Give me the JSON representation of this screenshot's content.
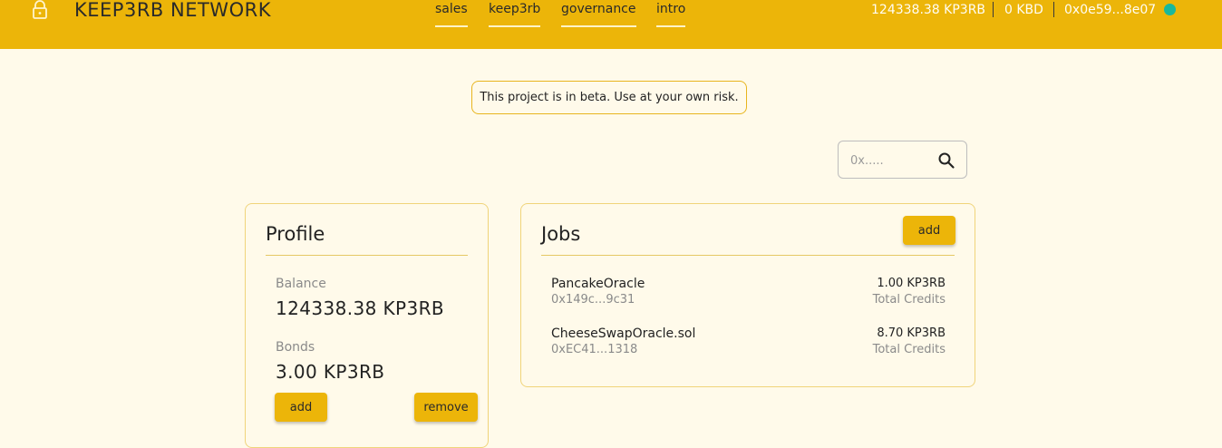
{
  "header": {
    "brand": "KEEP3RB NETWORK",
    "nav": [
      "sales",
      "keep3rb",
      "governance",
      "intro"
    ],
    "balance": "124338.38 KP3RB",
    "kbd": "0 KBD",
    "address": "0x0e59...8e07",
    "status_color": "#1ab89c",
    "accent_color": "#ecb509"
  },
  "notice": "This project is in beta. Use at your own risk.",
  "search": {
    "placeholder": "0x.....",
    "value": ""
  },
  "profile": {
    "title": "Profile",
    "balance_label": "Balance",
    "balance_value": "124338.38 KP3RB",
    "bonds_label": "Bonds",
    "bonds_value": "3.00 KP3RB",
    "add_label": "add",
    "remove_label": "remove"
  },
  "jobs": {
    "title": "Jobs",
    "add_label": "add",
    "items": [
      {
        "name": "PancakeOracle",
        "address": "0x149c...9c31",
        "credits": "1.00 KP3RB",
        "credits_label": "Total Credits"
      },
      {
        "name": "CheeseSwapOracle.sol",
        "address": "0xEC41...1318",
        "credits": "8.70 KP3RB",
        "credits_label": "Total Credits"
      }
    ]
  },
  "icons": {
    "lock": "lock-icon",
    "search": "search-icon"
  }
}
